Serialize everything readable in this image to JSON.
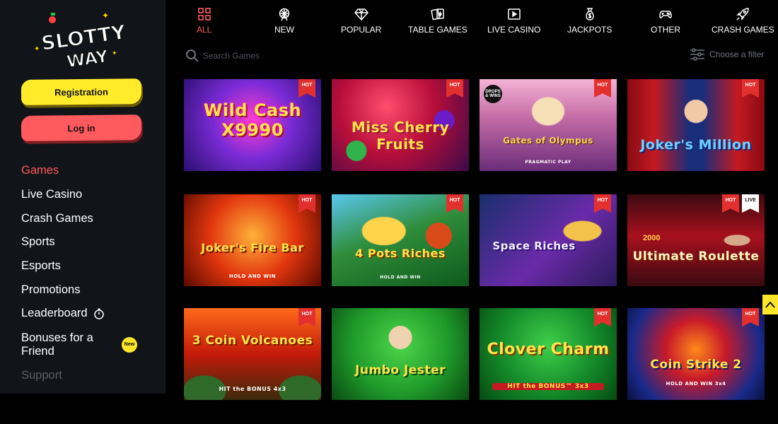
{
  "brand": {
    "logo_text_line1": "SLOTTY",
    "logo_text_line2": "WAY"
  },
  "auth": {
    "registration_label": "Registration",
    "login_label": "Log in"
  },
  "sidebar": {
    "items": [
      {
        "label": "Games",
        "state": "active"
      },
      {
        "label": "Live Casino"
      },
      {
        "label": "Crash Games"
      },
      {
        "label": "Sports"
      },
      {
        "label": "Esports"
      },
      {
        "label": "Promotions"
      },
      {
        "label": "Leaderboard",
        "icon": "trophy-icon"
      },
      {
        "label": "Bonuses for a Friend",
        "badge": "New"
      },
      {
        "label": "Support",
        "state": "muted"
      }
    ]
  },
  "categories": [
    {
      "label": "ALL",
      "icon": "grid-icon",
      "active": true
    },
    {
      "label": "NEW",
      "icon": "ferris-wheel-icon"
    },
    {
      "label": "POPULAR",
      "icon": "diamond-icon"
    },
    {
      "label": "TABLE GAMES",
      "icon": "cards-icon"
    },
    {
      "label": "LIVE CASINO",
      "icon": "live-video-icon"
    },
    {
      "label": "JACKPOTS",
      "icon": "money-bag-icon"
    },
    {
      "label": "OTHER",
      "icon": "gamepad-icon"
    },
    {
      "label": "CRASH GAMES",
      "icon": "rocket-icon"
    }
  ],
  "search": {
    "placeholder": "Search Games"
  },
  "filter": {
    "label": "Choose a filter"
  },
  "games": [
    {
      "title": "Wild Cash X9990",
      "badge": "HOT"
    },
    {
      "title": "Miss Cherry Fruits",
      "badge": "HOT"
    },
    {
      "title": "Gates of Olympus",
      "badge": "HOT",
      "corner_text": "DROPS & WINS",
      "provider": "PRAGMATIC PLAY"
    },
    {
      "title": "Joker's Million",
      "badge": "HOT"
    },
    {
      "title": "Joker's Fire Bar",
      "badge": "HOT",
      "subtitle": "HOLD AND WIN"
    },
    {
      "title": "4 Pots Riches",
      "badge": "HOT",
      "subtitle": "HOLD AND WIN"
    },
    {
      "title": "Space Riches",
      "badge": "HOT"
    },
    {
      "title": "Ultimate Roulette",
      "badge": "HOT",
      "badge2": "LIVE",
      "prefix": "2000"
    },
    {
      "title": "3 Coin Volcanoes",
      "badge": "HOT",
      "subtitle": "HIT the BONUS 4x3"
    },
    {
      "title": "Jumbo Jester"
    },
    {
      "title": "Clover Charm",
      "badge": "HOT",
      "subtitle": "HIT the BONUS™ 3x3"
    },
    {
      "title": "Coin Strike 2",
      "badge": "HOT",
      "subtitle": "HOLD AND WIN 3x4"
    }
  ],
  "colors": {
    "accent": "#ff5a5e",
    "yellow": "#ffeb2a",
    "sidebar_bg": "#111419",
    "page_bg": "#000000"
  }
}
